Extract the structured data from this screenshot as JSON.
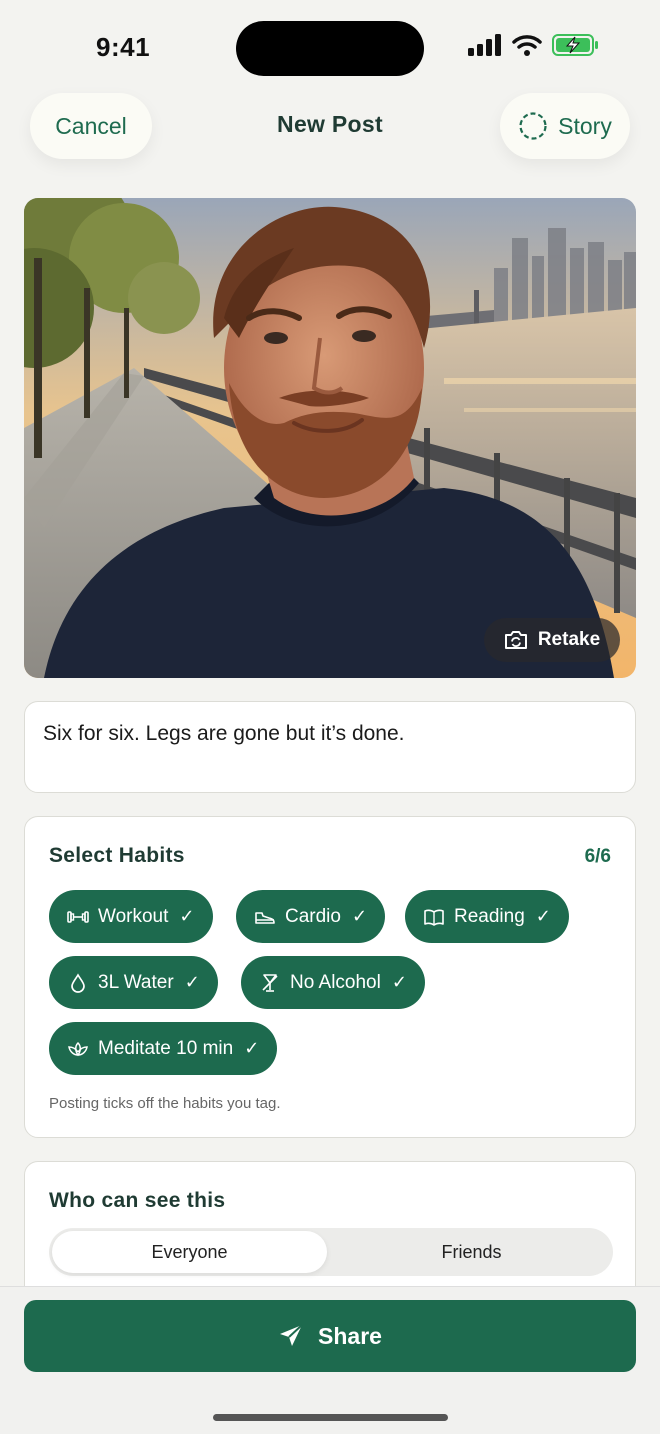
{
  "status_bar": {
    "time": "9:41"
  },
  "header": {
    "cancel_label": "Cancel",
    "title": "New Post",
    "story_label": "Story"
  },
  "photo": {
    "retake_label": "Retake",
    "icon": "camera-rotate-icon"
  },
  "caption": {
    "value": "Six for six. Legs are gone but it’s done."
  },
  "habits": {
    "title": "Select Habits",
    "count": "6/6",
    "items": [
      {
        "label": "Workout",
        "icon": "dumbbell-icon"
      },
      {
        "label": "Cardio",
        "icon": "shoe-icon"
      },
      {
        "label": "Reading",
        "icon": "book-icon"
      },
      {
        "label": "3L Water",
        "icon": "droplet-icon"
      },
      {
        "label": "No Alcohol",
        "icon": "no-alcohol-icon"
      },
      {
        "label": "Meditate 10 min",
        "icon": "lotus-icon"
      }
    ],
    "check": "✓",
    "helper": "Posting ticks off the habits you tag."
  },
  "visibility": {
    "title": "Who can see this",
    "options": [
      "Everyone",
      "Friends"
    ],
    "selected": "Everyone"
  },
  "share": {
    "label": "Share",
    "icon": "send-icon"
  },
  "colors": {
    "accent": "#1d6a4e",
    "background": "#f3f3f0"
  }
}
